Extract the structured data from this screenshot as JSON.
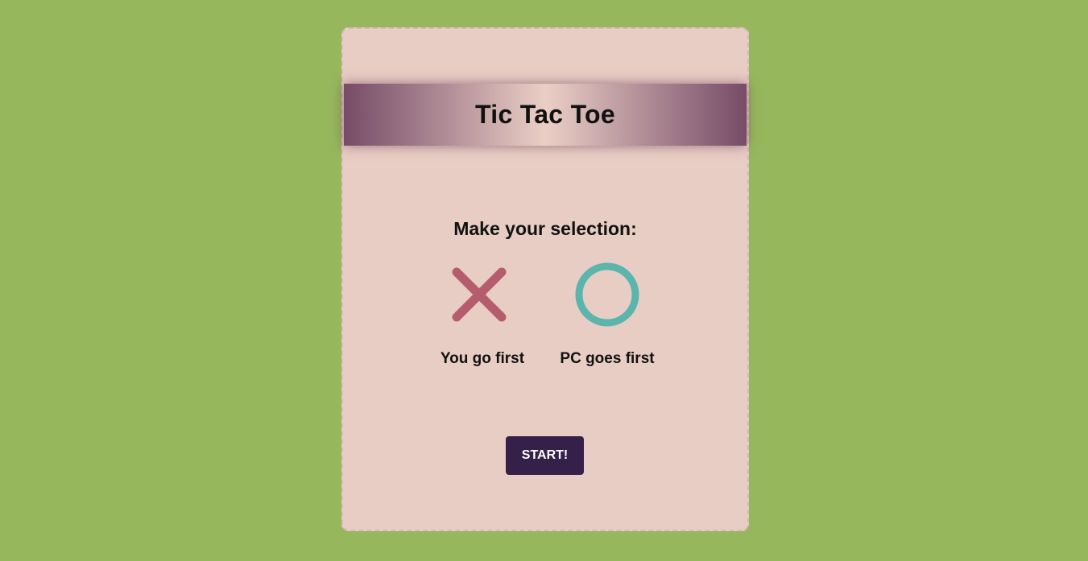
{
  "header": {
    "title": "Tic Tac Toe"
  },
  "selection": {
    "prompt": "Make your selection:",
    "options": [
      {
        "icon": "x-mark-icon",
        "label": "You go first",
        "color": "#b55d6c"
      },
      {
        "icon": "o-ring-icon",
        "label": "PC goes first",
        "color": "#5bb5ad"
      }
    ]
  },
  "start_button": {
    "label": "START!",
    "color": "#35204a"
  },
  "colors": {
    "background": "#97b75d",
    "card": "#e8cdc4",
    "banner_dark": "#774c67",
    "banner_light": "#ebcfc6"
  }
}
